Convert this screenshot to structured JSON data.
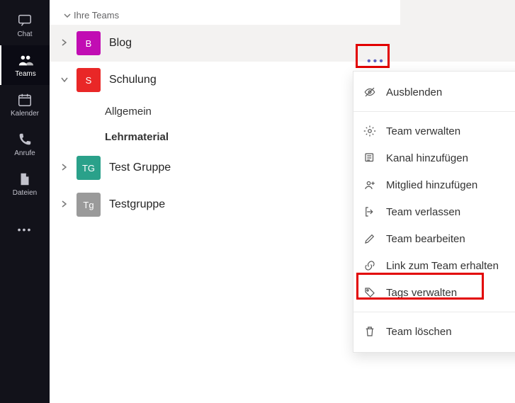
{
  "rail": {
    "items": [
      {
        "key": "chat",
        "label": "Chat"
      },
      {
        "key": "teams",
        "label": "Teams"
      },
      {
        "key": "kalender",
        "label": "Kalender"
      },
      {
        "key": "anrufe",
        "label": "Anrufe"
      },
      {
        "key": "dateien",
        "label": "Dateien"
      }
    ],
    "active": "teams",
    "more": "•••"
  },
  "teams_header": "Ihre Teams",
  "teams": [
    {
      "name": "Blog",
      "initial": "B",
      "color": "#c10db3",
      "expanded": false,
      "highlighted": true
    },
    {
      "name": "Schulung",
      "initial": "S",
      "color": "#e92727",
      "expanded": true,
      "channels": [
        {
          "name": "Allgemein",
          "bold": false
        },
        {
          "name": "Lehrmaterial",
          "bold": true
        }
      ]
    },
    {
      "name": "Test Gruppe",
      "initial": "TG",
      "color": "#2aa18a",
      "expanded": false
    },
    {
      "name": "Testgruppe",
      "initial": "Tg",
      "color": "#9a9a9a",
      "expanded": false
    }
  ],
  "context_menu": {
    "trigger": "•••",
    "groups": [
      [
        {
          "key": "ausblenden",
          "label": "Ausblenden"
        }
      ],
      [
        {
          "key": "team-verwalten",
          "label": "Team verwalten"
        },
        {
          "key": "kanal-hinzufuegen",
          "label": "Kanal hinzufügen"
        },
        {
          "key": "mitglied-hinzufuegen",
          "label": "Mitglied hinzufügen"
        },
        {
          "key": "team-verlassen",
          "label": "Team verlassen"
        },
        {
          "key": "team-bearbeiten",
          "label": "Team bearbeiten"
        },
        {
          "key": "link-zum-team",
          "label": "Link zum Team erhalten"
        },
        {
          "key": "tags-verwalten",
          "label": "Tags verwalten",
          "emph": true
        }
      ],
      [
        {
          "key": "team-loeschen",
          "label": "Team löschen"
        }
      ]
    ]
  }
}
